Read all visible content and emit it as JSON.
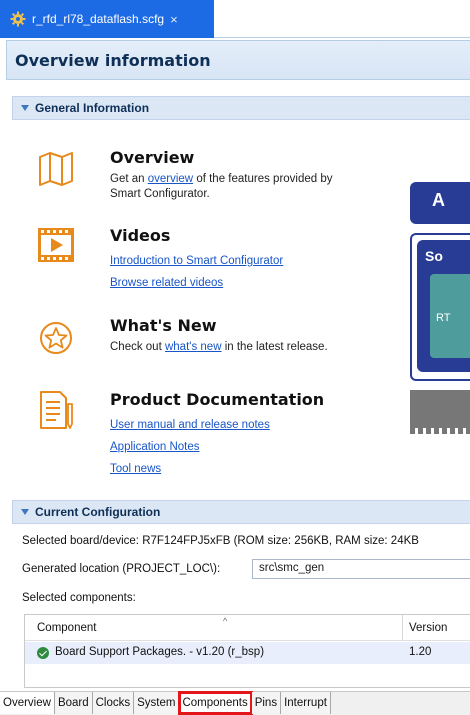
{
  "tab": {
    "title": "r_rfd_rl78_dataflash.scfg",
    "close": "×",
    "icon": "gear-icon"
  },
  "header": {
    "title": "Overview information"
  },
  "general": {
    "title": "General Information",
    "overview": {
      "title": "Overview",
      "text_prefix": "Get an",
      "link": "overview",
      "text_suffix": "of the features provided by",
      "text_line2": "Smart Configurator."
    },
    "videos": {
      "title": "Videos",
      "link1": "Introduction to Smart Configurator",
      "link2": "Browse related videos"
    },
    "whatsnew": {
      "title": "What's New",
      "text_prefix": "Check out",
      "link": "what's new",
      "text_suffix": "in the latest release."
    },
    "docs": {
      "title": "Product Documentation",
      "link1": "User manual and release notes",
      "link2": "Application Notes",
      "link3": "Tool news"
    },
    "diagram": {
      "top": "A",
      "box": "So",
      "chip": "RT"
    }
  },
  "current": {
    "title": "Current Configuration",
    "board_label": "Selected board/device:",
    "board_value": "R7F124FPJ5xFB (ROM size: 256KB, RAM size: 24KB",
    "location_label": "Generated location (PROJECT_LOC\\):",
    "location_value": "src\\smc_gen",
    "components_label": "Selected components:",
    "columns": {
      "component": "Component",
      "version": "Version"
    },
    "rows": [
      {
        "component": "Board Support Packages. - v1.20 (r_bsp)",
        "version": "1.20"
      }
    ]
  },
  "bottom_tabs": [
    "Overview",
    "Board",
    "Clocks",
    "System",
    "Components",
    "Pins",
    "Interrupt"
  ],
  "colors": {
    "accent": "#1d6ae5",
    "highlight": "#e3161c",
    "icon_orange": "#e8891c"
  }
}
